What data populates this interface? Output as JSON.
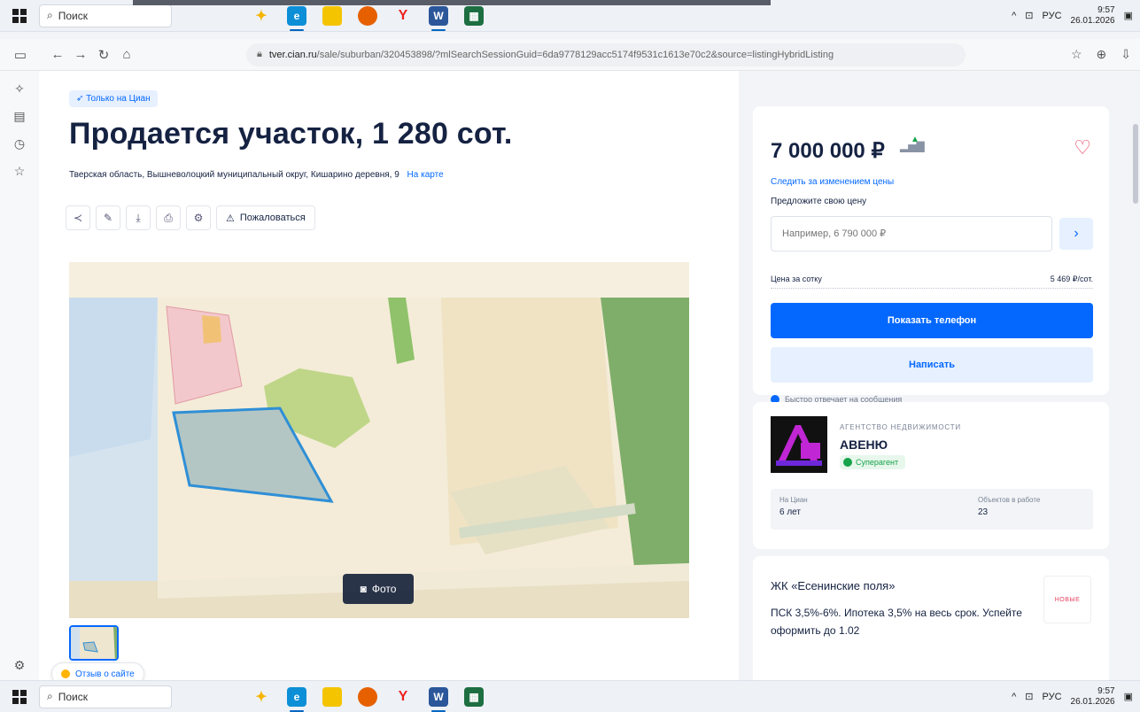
{
  "taskbar": {
    "search_placeholder": "Поиск",
    "lang": "РУС",
    "time": "9:57",
    "date": "26.01.2026",
    "apps": [
      {
        "name": "copilot-icon",
        "color": "#f5b400",
        "glyph": "✦"
      },
      {
        "name": "edge-icon",
        "color": "#0c8fd6",
        "glyph": "e"
      },
      {
        "name": "files-icon",
        "color": "#f5c400",
        "glyph": "▬"
      },
      {
        "name": "firefox-icon",
        "color": "#e66000",
        "glyph": "●"
      },
      {
        "name": "yandex-icon",
        "color": "#ffffff",
        "glyph": "Y"
      },
      {
        "name": "word-icon",
        "color": "#2b579a",
        "glyph": "W"
      },
      {
        "name": "sheet-icon",
        "color": "#1d6f42",
        "glyph": "▦"
      }
    ]
  },
  "top_banner_text": "ПСК 3,5%-6%, Ипотека 3,5% на весь срок.",
  "browser": {
    "url_host": "tver.cian.ru",
    "url_rest": "/sale/suburban/320453898/?mlSearchSessionGuid=6da9778129acc5174f9531c1613e70c2&source=listingHybridListing"
  },
  "listing": {
    "badge": "Только на Циан",
    "title": "Продается участок, 1 280 сот.",
    "address": "Тверская область, Вышневолоцкий муниципальный округ, Кишарино деревня, 9",
    "map_link": "На карте",
    "report_label": "Пожаловаться",
    "photo_button": "Фото",
    "feedback": "Отзыв о сайте"
  },
  "price_card": {
    "price": "7 000 000 ₽",
    "watch_link": "Следить за изменением цены",
    "offer_label": "Предложите свою цену",
    "offer_placeholder": "Например, 6 790 000 ₽",
    "per_sotka_label": "Цена за сотку",
    "per_sotka_value": "5 469 ₽/сот.",
    "phone_button": "Показать телефон",
    "write_button": "Написать",
    "replies_note": "Быстро отвечает на сообщения"
  },
  "agency": {
    "type": "АГЕНТСТВО НЕДВИЖИМОСТИ",
    "name": "АВЕНЮ",
    "badge": "Суперагент",
    "stats": [
      {
        "label": "На Циан",
        "value": "6 лет"
      },
      {
        "label": "Объектов в работе",
        "value": "23"
      }
    ]
  },
  "promo": {
    "title": "ЖК «Есенинские поля»",
    "text": "ПСК 3,5%-6%. Ипотека 3,5% на весь срок. Успейте оформить до 1.02",
    "logo_text": "НОВЫЕ"
  },
  "colors": {
    "accent": "#0468ff",
    "accent_light": "#e6f0ff",
    "heart": "#e84260",
    "super_green": "#16a34a"
  }
}
